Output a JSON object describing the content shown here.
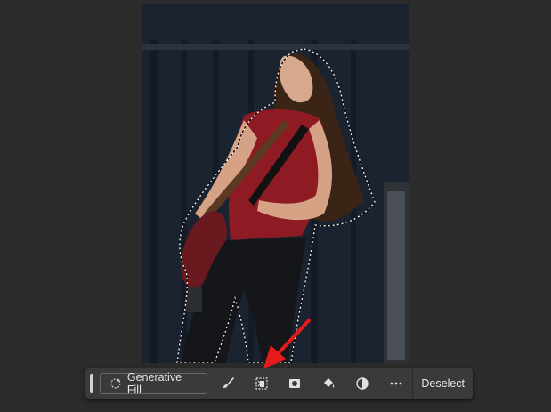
{
  "contextual_taskbar": {
    "generative_fill_label": "Generative Fill",
    "deselect_label": "Deselect",
    "tools": [
      {
        "icon": "brush-icon"
      },
      {
        "icon": "select-subject-icon"
      },
      {
        "icon": "mask-icon"
      },
      {
        "icon": "paint-bucket-icon"
      },
      {
        "icon": "adjustment-icon"
      },
      {
        "icon": "more-icon"
      }
    ]
  },
  "annotation": {
    "color": "#e51b1b"
  }
}
